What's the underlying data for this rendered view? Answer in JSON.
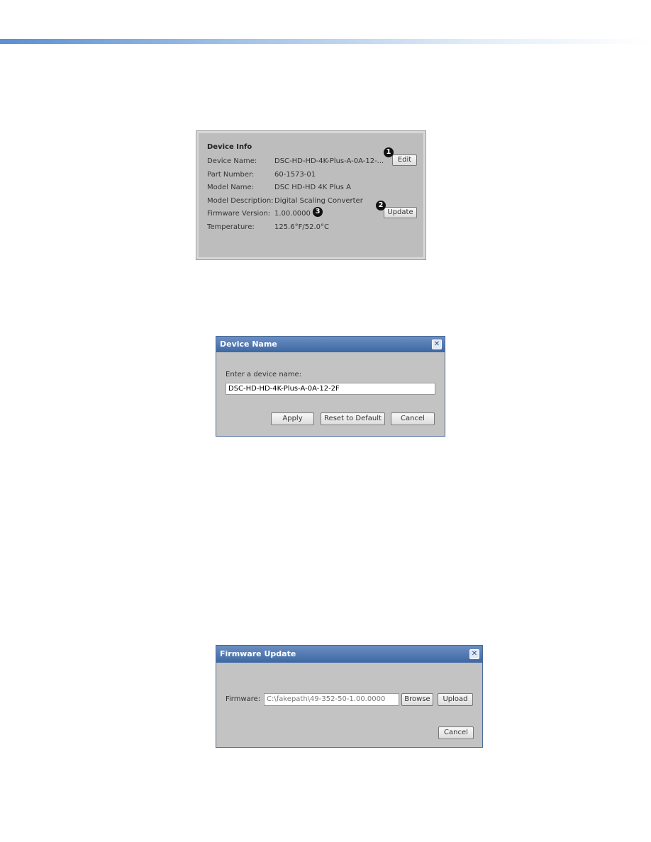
{
  "device_info": {
    "title": "Device Info",
    "rows": [
      {
        "label": "Device Name:",
        "value": "DSC-HD-HD-4K-Plus-A-0A-12-..."
      },
      {
        "label": "Part Number:",
        "value": "60-1573-01"
      },
      {
        "label": "Model Name:",
        "value": "DSC HD-HD 4K Plus A"
      },
      {
        "label": "Model Description:",
        "value": "Digital Scaling Converter"
      },
      {
        "label": "Firmware Version:",
        "value": "1.00.0000"
      },
      {
        "label": "Temperature:",
        "value": "125.6°F/52.0°C"
      }
    ],
    "edit_label": "Edit",
    "update_label": "Update",
    "callouts": [
      "1",
      "2",
      "3"
    ]
  },
  "device_name_dialog": {
    "title": "Device Name",
    "close": "✕",
    "prompt": "Enter a device name:",
    "value": "DSC-HD-HD-4K-Plus-A-0A-12-2F",
    "apply": "Apply",
    "reset": "Reset to Default",
    "cancel": "Cancel"
  },
  "firmware_dialog": {
    "title": "Firmware Update",
    "close": "✕",
    "label": "Firmware:",
    "value": "C:\\fakepath\\49-352-50-1.00.0000",
    "browse": "Browse",
    "upload": "Upload",
    "cancel": "Cancel"
  }
}
